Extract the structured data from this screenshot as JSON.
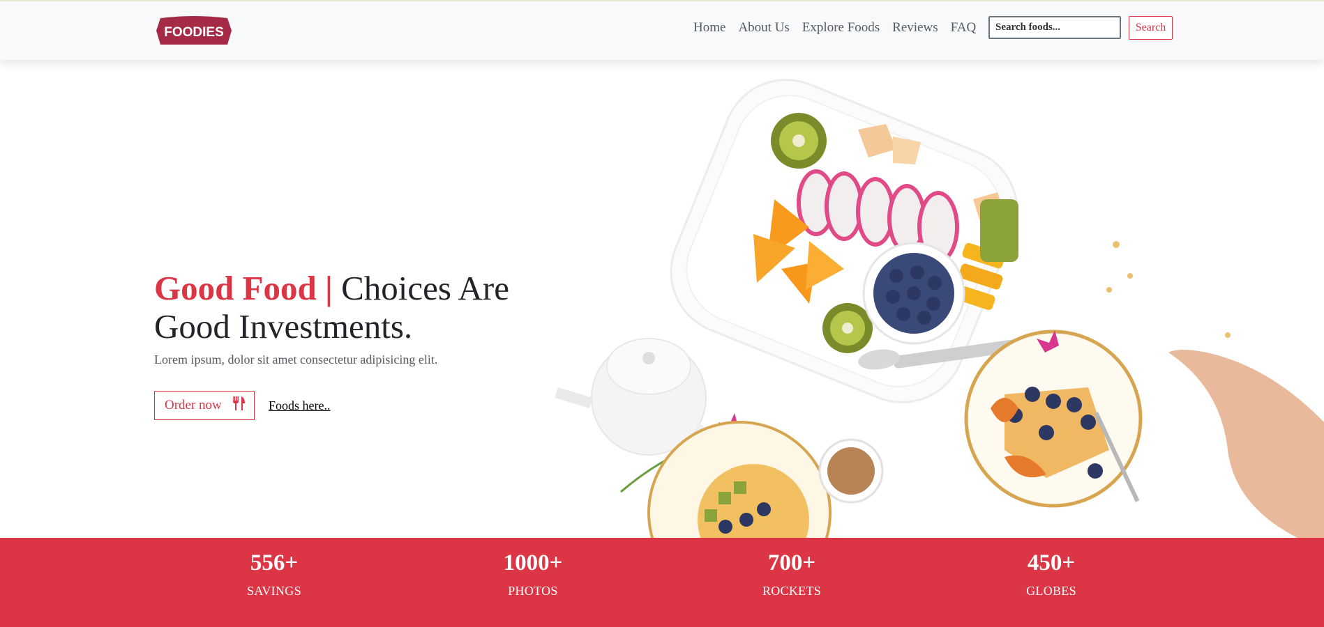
{
  "brand": {
    "logo_text": "FOODIES",
    "accent_color": "#dc3545",
    "logo_color": "#a52a45"
  },
  "nav": {
    "links": [
      {
        "label": "Home"
      },
      {
        "label": "About Us"
      },
      {
        "label": "Explore Foods"
      },
      {
        "label": "Reviews"
      },
      {
        "label": "FAQ"
      }
    ],
    "search_placeholder": "Search foods...",
    "search_button": "Search"
  },
  "hero": {
    "title_accent": "Good Food |",
    "title_rest": " Choices Are Good Investments.",
    "description": "Lorem ipsum, dolor sit amet consectetur adipisicing elit.",
    "order_button": "Order now",
    "order_icon": "utensils-icon",
    "foods_link": "Foods here.."
  },
  "stats": [
    {
      "value": "556+",
      "label": "SAVINGS"
    },
    {
      "value": "1000+",
      "label": "PHOTOS"
    },
    {
      "value": "700+",
      "label": "ROCKETS"
    },
    {
      "value": "450+",
      "label": "GLOBES"
    }
  ]
}
